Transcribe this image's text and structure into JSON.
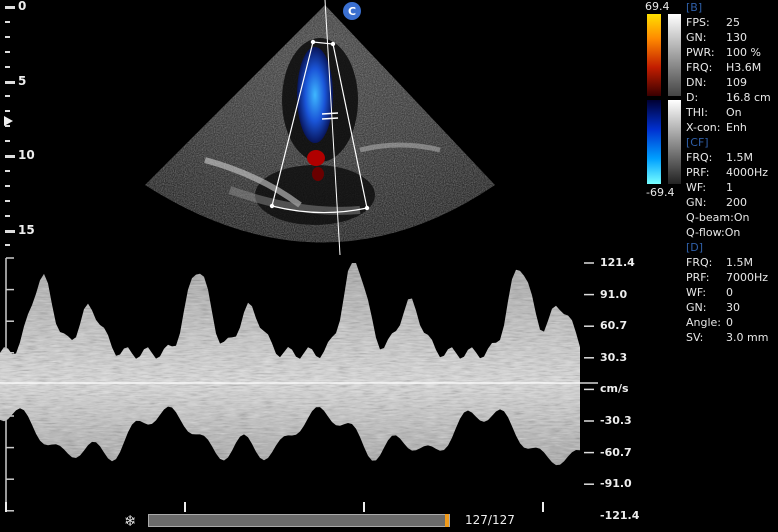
{
  "depth_scale": {
    "labels": [
      "0",
      "5",
      "10",
      "15"
    ]
  },
  "probe_badge": "C",
  "color_scale": {
    "top_value": "69.4",
    "bottom_value": "-69.4"
  },
  "params": {
    "b_header": "[B]",
    "b_rows": [
      {
        "key": "FPS:",
        "value": "25"
      },
      {
        "key": "GN:",
        "value": "130"
      },
      {
        "key": "PWR:",
        "value": "100 %"
      },
      {
        "key": "FRQ:",
        "value": "H3.6M"
      },
      {
        "key": "DN:",
        "value": "109"
      },
      {
        "key": "D:",
        "value": "16.8 cm"
      },
      {
        "key": "THI:",
        "value": "On"
      },
      {
        "key": "X-con:",
        "value": "Enh"
      }
    ],
    "cf_header": "[CF]",
    "cf_rows": [
      {
        "key": "FRQ:",
        "value": "1.5M"
      },
      {
        "key": "PRF:",
        "value": "4000Hz"
      },
      {
        "key": "WF:",
        "value": "1"
      },
      {
        "key": "GN:",
        "value": "200"
      },
      {
        "key": "Q-beam:",
        "value": "On"
      },
      {
        "key": "Q-flow:",
        "value": "On"
      }
    ],
    "d_header": "[D]",
    "d_rows": [
      {
        "key": "FRQ:",
        "value": "1.5M"
      },
      {
        "key": "PRF:",
        "value": "7000Hz"
      },
      {
        "key": "WF:",
        "value": "0"
      },
      {
        "key": "GN:",
        "value": "30"
      },
      {
        "key": "Angle:",
        "value": "0"
      },
      {
        "key": "SV:",
        "value": "3.0 mm"
      }
    ]
  },
  "velocity_scale": {
    "labels": [
      "121.4",
      "91.0",
      "60.7",
      "30.3",
      "cm/s",
      "-30.3",
      "-60.7",
      "-91.0",
      "-121.4"
    ]
  },
  "cine": {
    "progress": 1.0,
    "frame_counter": "127/127"
  },
  "colors": {
    "accent_badge": "#3a6fd0",
    "param_header": "#2f5fa8",
    "cine_thumb": "#f09a1a"
  }
}
